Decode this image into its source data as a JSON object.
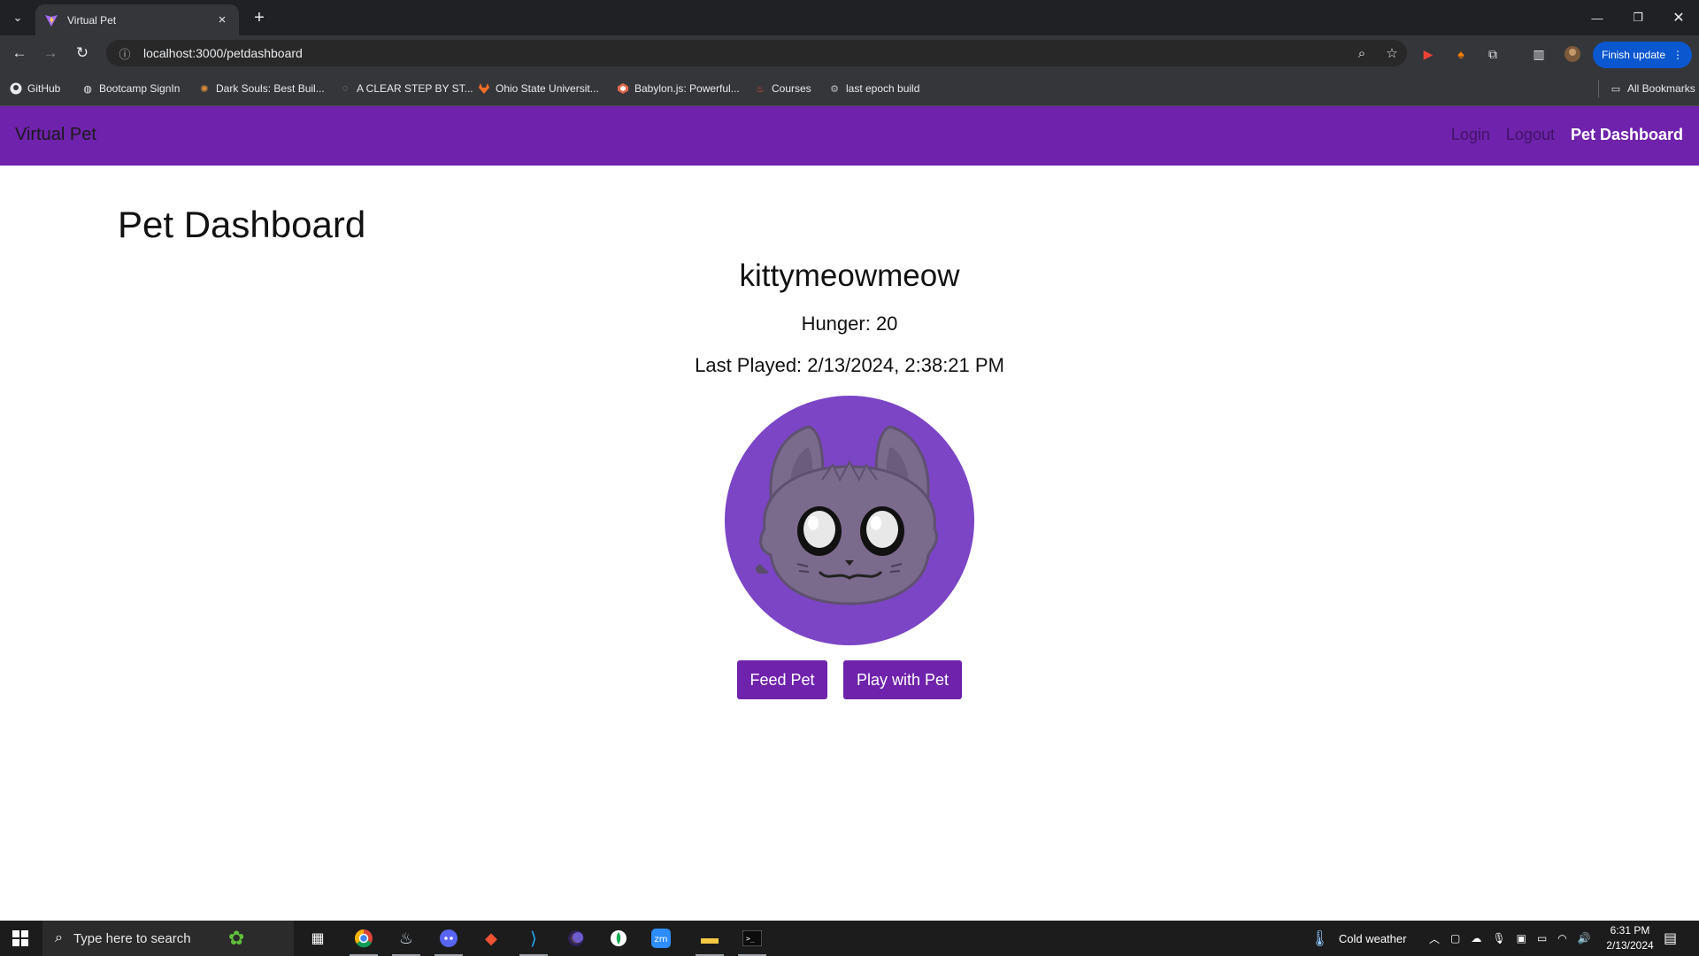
{
  "browser": {
    "tab_title": "Virtual Pet",
    "url": "localhost:3000/petdashboard",
    "finish_update_label": "Finish update",
    "bookmarks": [
      {
        "label": "GitHub",
        "icon": "github-icon"
      },
      {
        "label": "Bootcamp SignIn",
        "icon": "globe-icon"
      },
      {
        "label": "Dark Souls: Best Buil...",
        "icon": "darksouls-icon"
      },
      {
        "label": "A CLEAR STEP BY ST...",
        "icon": "loading-icon"
      },
      {
        "label": "Ohio State Universit...",
        "icon": "gitlab-icon"
      },
      {
        "label": "Babylon.js: Powerful...",
        "icon": "babylon-icon"
      },
      {
        "label": "Courses",
        "icon": "fire-icon"
      },
      {
        "label": "last epoch build",
        "icon": "epoch-icon"
      }
    ],
    "all_bookmarks_label": "All Bookmarks"
  },
  "app": {
    "brand": "Virtual Pet",
    "nav": {
      "login": "Login",
      "logout": "Logout",
      "dashboard": "Pet Dashboard"
    },
    "page_title": "Pet Dashboard",
    "pet": {
      "name": "kittymeowmeow",
      "hunger_text": "Hunger: 20",
      "last_played_text": "Last Played: 2/13/2024, 2:38:21 PM"
    },
    "buttons": {
      "feed": "Feed Pet",
      "play": "Play with Pet"
    },
    "colors": {
      "nav_bg": "#6f22ab",
      "button_bg": "#6f22ab",
      "avatar_bg": "#7b45c6"
    }
  },
  "taskbar": {
    "search_placeholder": "Type here to search",
    "weather": "Cold weather",
    "time": "6:31 PM",
    "date": "2/13/2024"
  }
}
